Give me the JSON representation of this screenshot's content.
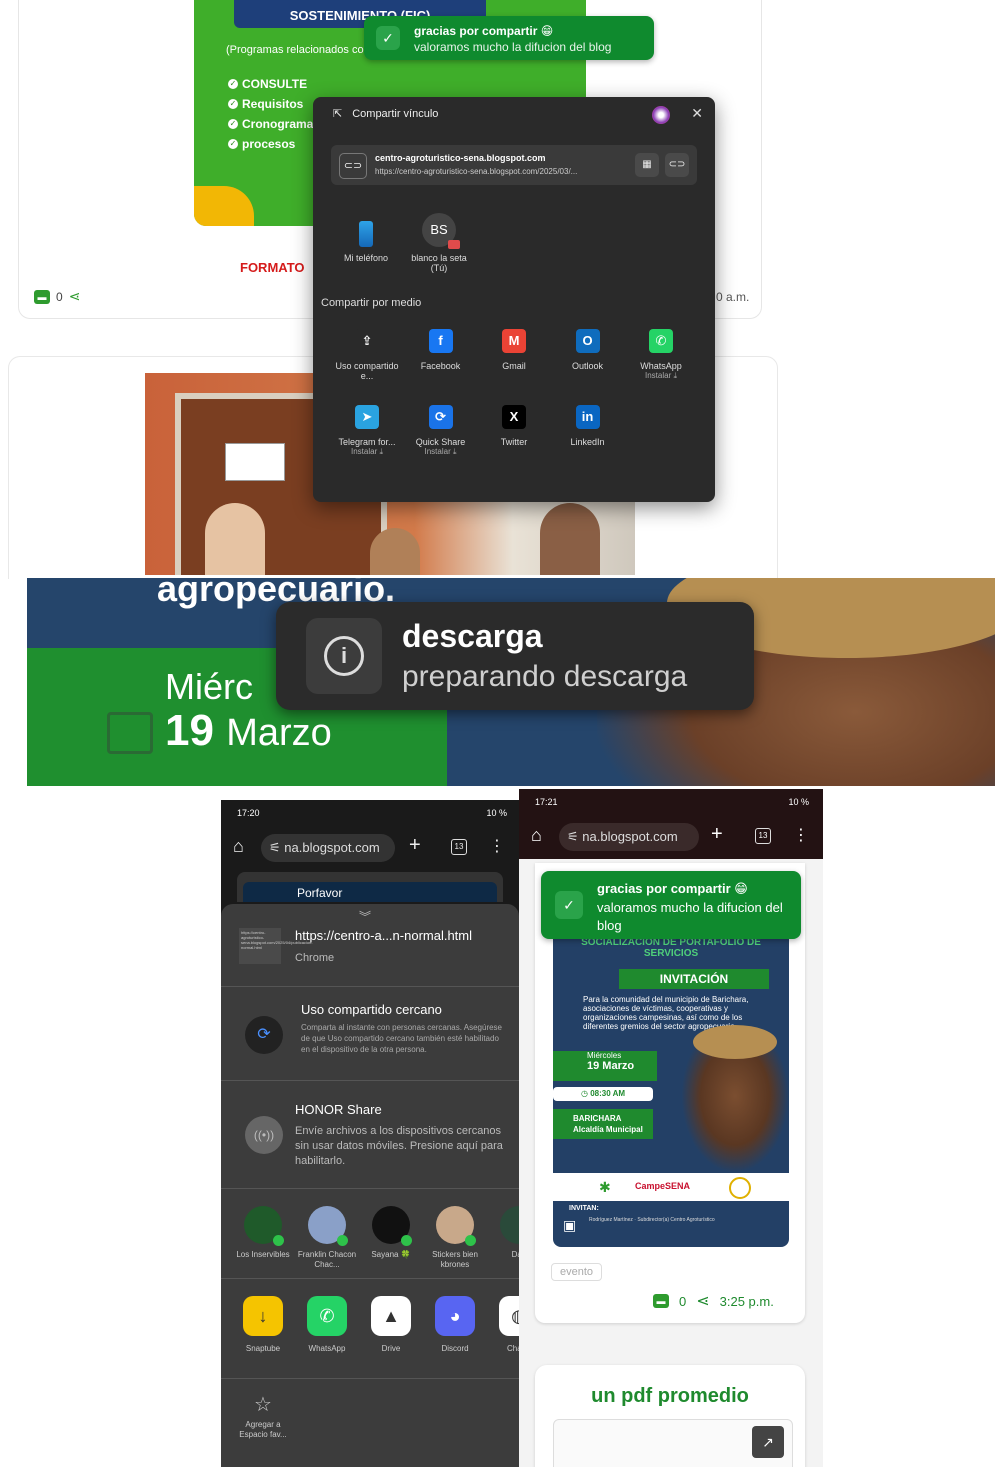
{
  "panel1": {
    "green_banner_title": "SOSTENIMIENTO (FIC)",
    "green_subtitle": "(Programas relacionados co",
    "green_list": [
      "CONSULTE",
      "Requisitos",
      "Cronograma",
      "procesos"
    ],
    "formato_label": "FORMATO",
    "comment_count": "0",
    "time_partial": "0 a.m.",
    "toast": {
      "title": "gracias por compartir 😁",
      "subtitle": "valoramos mucho la difucion del blog"
    },
    "share_dialog": {
      "title": "Compartir vínculo",
      "close": "✕",
      "link_title": "centro-agroturistico-sena.blogspot.com",
      "link_url": "https://centro-agroturistico-sena.blogspot.com/2025/03/...",
      "devices": [
        {
          "label": "Mi teléfono"
        },
        {
          "initials": "BS",
          "label": "blanco la seta (Tú)"
        }
      ],
      "share_via": "Compartir por medio",
      "apps": [
        {
          "label": "Uso compartido e...",
          "install": "",
          "icon": "⇪",
          "color": "#2a2a2a"
        },
        {
          "label": "Facebook",
          "install": "",
          "icon": "f",
          "color": "#1877f2"
        },
        {
          "label": "Gmail",
          "install": "",
          "icon": "M",
          "color": "#ea4335"
        },
        {
          "label": "Outlook",
          "install": "",
          "icon": "O",
          "color": "#0f6cbd"
        },
        {
          "label": "WhatsApp",
          "install": "Instalar ⤓",
          "icon": "✆",
          "color": "#25d366"
        },
        {
          "label": "Telegram for...",
          "install": "Instalar ⤓",
          "icon": "➤",
          "color": "#2aa3e0"
        },
        {
          "label": "Quick Share",
          "install": "Instalar ⤓",
          "icon": "⟳",
          "color": "#1a73e8"
        },
        {
          "label": "Twitter",
          "install": "",
          "icon": "X",
          "color": "#000000"
        },
        {
          "label": "LinkedIn",
          "install": "",
          "icon": "in",
          "color": "#0a66c2"
        }
      ]
    }
  },
  "panel2": {
    "headline": "agropecuario.",
    "day": "Miérc",
    "date_number": "19",
    "date_month": "Marzo",
    "download_toast": {
      "title": "descarga",
      "subtitle": "preparando descarga"
    }
  },
  "panel3": {
    "status_time": "17:20",
    "status_right": "10 %",
    "url": "na.blogspot.com",
    "tab_count": "13",
    "background_text": "Porfavor",
    "share_url": "https://centro-a...n-normal.html",
    "share_source": "Chrome",
    "thumb_text": "https://centro-agroturistico-sena.blogspot.com/2025/04/publicacion-normal.html",
    "nearby_title": "Uso compartido cercano",
    "nearby_desc": "Comparta al instante con personas cercanas. Asegúrese de que Uso compartido cercano también esté habilitado en el dispositivo de la otra persona.",
    "honor_title": "HONOR Share",
    "honor_desc": "Envíe archivos a los dispositivos cercanos sin usar datos móviles. Presione aquí para habilitarlo.",
    "contacts": [
      {
        "name": "Los Inservibles",
        "color": "#1f5a2a"
      },
      {
        "name": "Franklin Chacon Chac...",
        "color": "#8aa0c8"
      },
      {
        "name": "Sayana 🍀",
        "color": "#111111"
      },
      {
        "name": "Stickers bien kbrones",
        "color": "#c8a88a"
      },
      {
        "name": "Dan",
        "color": "#2a4a3a"
      }
    ],
    "apps": [
      {
        "name": "Snaptube",
        "icon": "↓",
        "color": "#f5c400"
      },
      {
        "name": "WhatsApp",
        "icon": "✆",
        "color": "#25d366"
      },
      {
        "name": "Drive",
        "icon": "▲",
        "color": "#ffffff"
      },
      {
        "name": "Discord",
        "icon": "◕",
        "color": "#5865f2"
      },
      {
        "name": "Chat A",
        "icon": "◍",
        "color": "#ffffff"
      }
    ],
    "favorite": "Agregar a Espacio fav..."
  },
  "panel4": {
    "status_time": "17:21",
    "status_right": "10 %",
    "url": "na.blogspot.com",
    "tab_count": "13",
    "toast": {
      "title": "gracias por compartir 😁",
      "subtitle": "valoramos mucho la difucion del blog"
    },
    "invitation": {
      "subtitle": "SOCIALIZACIÓN DE PORTAFOLIO DE SERVICIOS",
      "label": "INVITACIÓN",
      "paragraph": "Para la comunidad del municipio de Barichara, asociaciones de víctimas, cooperativas y organizaciones campesinas, así como de los diferentes gremios del sector agropecuario.",
      "day": "Miércoles",
      "date": "19 Marzo",
      "time": "08:30 AM",
      "place": "BARICHARA",
      "place_sub": "Alcaldía Municipal",
      "campesena": "CampeSENA",
      "invitan": "INVITAN:",
      "invitan_names": "Rodríguez Martínez · Subdirector(a) Centro Agroturístico"
    },
    "tag": "evento",
    "comment_count": "0",
    "time": "3:25 p.m.",
    "next_post_title": "un pdf promedio"
  }
}
